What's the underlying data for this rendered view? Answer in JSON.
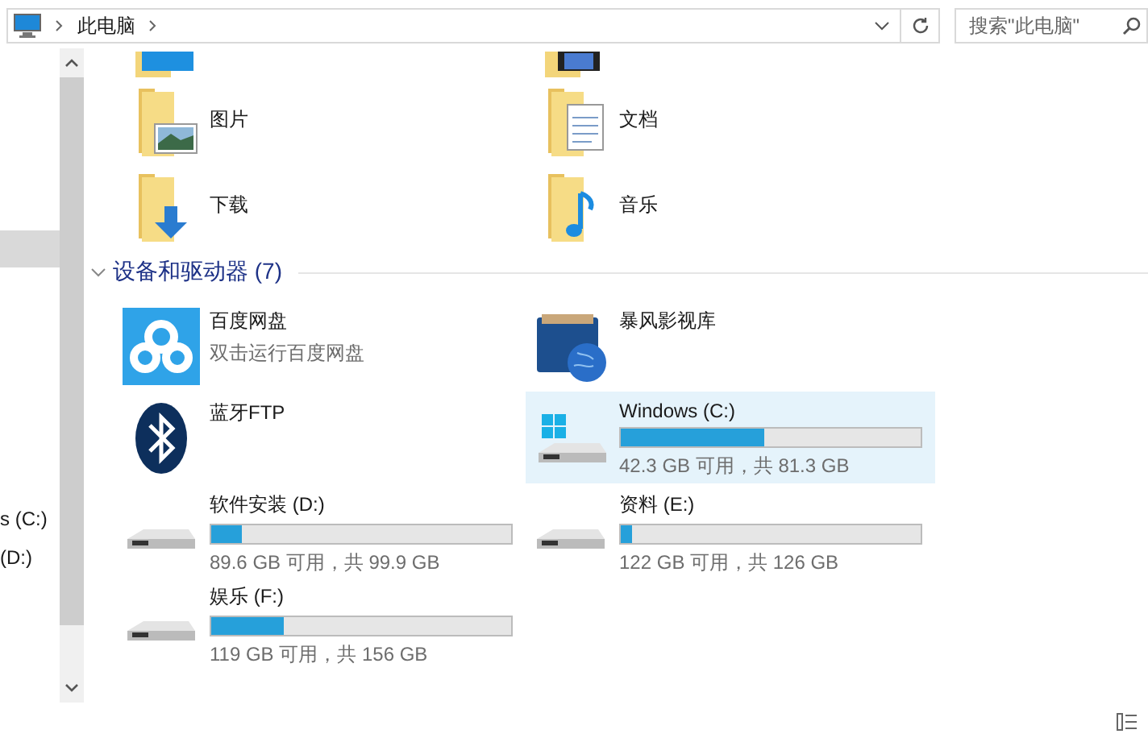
{
  "address_bar": {
    "path": "此电脑"
  },
  "search": {
    "placeholder": "搜索\"此电脑\""
  },
  "nav_pane": {
    "items": [
      {
        "label": "s (C:)"
      },
      {
        "label": "(D:)"
      }
    ]
  },
  "folders": {
    "partial_row": [
      {
        "kind": "desktop"
      },
      {
        "kind": "videos"
      }
    ],
    "items": [
      {
        "kind": "pictures",
        "name": "图片"
      },
      {
        "kind": "documents",
        "name": "文档"
      },
      {
        "kind": "downloads",
        "name": "下载"
      },
      {
        "kind": "music",
        "name": "音乐"
      }
    ]
  },
  "devices": {
    "title": "设备和驱动器 (7)",
    "expanded": true,
    "items": [
      {
        "kind": "cloud",
        "name": "百度网盘",
        "subtitle": "双击运行百度网盘",
        "selected": false
      },
      {
        "kind": "media",
        "name": "暴风影视库",
        "selected": false
      },
      {
        "kind": "bluetooth",
        "name": "蓝牙FTP",
        "selected": false
      },
      {
        "kind": "system",
        "name": "Windows (C:)",
        "level": 0.48,
        "free": "42.3 GB 可用，共 81.3 GB",
        "selected": true
      },
      {
        "kind": "drive",
        "name": "软件安装 (D:)",
        "level": 0.1,
        "free": "89.6 GB 可用，共 99.9 GB",
        "selected": false
      },
      {
        "kind": "drive",
        "name": "资料 (E:)",
        "level": 0.04,
        "free": "122 GB 可用，共 126 GB",
        "selected": false
      },
      {
        "kind": "drive",
        "name": "娱乐 (F:)",
        "level": 0.24,
        "free": "119 GB 可用，共 156 GB",
        "selected": false
      }
    ]
  }
}
